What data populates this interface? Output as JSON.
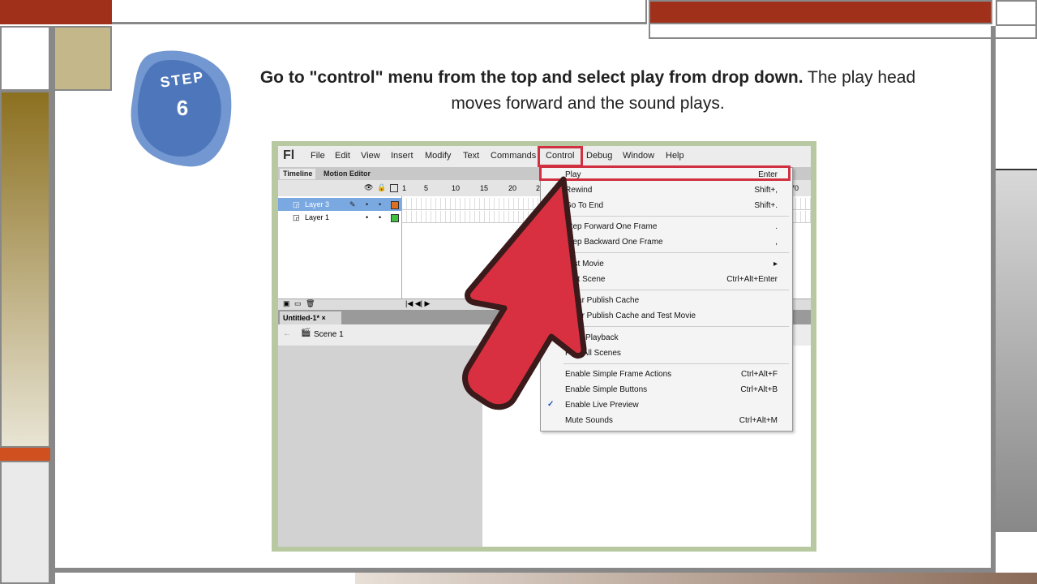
{
  "step": {
    "label": "STEP",
    "number": "6"
  },
  "instruction": {
    "bold": "Go to \"control\" menu from the top and select play from drop down.",
    "rest": " The play head moves forward and the sound plays."
  },
  "colors": {
    "accent": "#a0301a",
    "badge": "#4a78c0",
    "arrow": "#d83040",
    "highlight": "#d03040"
  },
  "app": {
    "logo": "Fl",
    "menu": [
      "File",
      "Edit",
      "View",
      "Insert",
      "Modify",
      "Text",
      "Commands",
      "Control",
      "Debug",
      "Window",
      "Help"
    ],
    "panel_tabs": [
      "Timeline",
      "Motion Editor"
    ],
    "frame_numbers": [
      "1",
      "5",
      "10",
      "15",
      "20",
      "2",
      "70"
    ],
    "layers": [
      "Layer 3",
      "Layer 1"
    ],
    "doc_tab": "Untitled-1* ×",
    "scene": "Scene 1",
    "control_menu": [
      {
        "label": "Play",
        "shortcut": "Enter"
      },
      {
        "label": "Rewind",
        "shortcut": "Shift+,"
      },
      {
        "label": "Go To End",
        "shortcut": "Shift+."
      },
      {
        "label": "Step Forward One Frame",
        "shortcut": "."
      },
      {
        "label": "Step Backward One Frame",
        "shortcut": ","
      },
      {
        "label": "Test Movie",
        "shortcut": "▸"
      },
      {
        "label": "Test Scene",
        "shortcut": "Ctrl+Alt+Enter"
      },
      {
        "label": "Clear Publish Cache",
        "shortcut": ""
      },
      {
        "label": "Clear Publish Cache and Test Movie",
        "shortcut": ""
      },
      {
        "label": "Loop Playback",
        "shortcut": ""
      },
      {
        "label": "Play All Scenes",
        "shortcut": ""
      },
      {
        "label": "Enable Simple Frame Actions",
        "shortcut": "Ctrl+Alt+F"
      },
      {
        "label": "Enable Simple Buttons",
        "shortcut": "Ctrl+Alt+B"
      },
      {
        "label": "Enable Live Preview",
        "shortcut": "",
        "checked": true
      },
      {
        "label": "Mute Sounds",
        "shortcut": "Ctrl+Alt+M"
      }
    ]
  }
}
